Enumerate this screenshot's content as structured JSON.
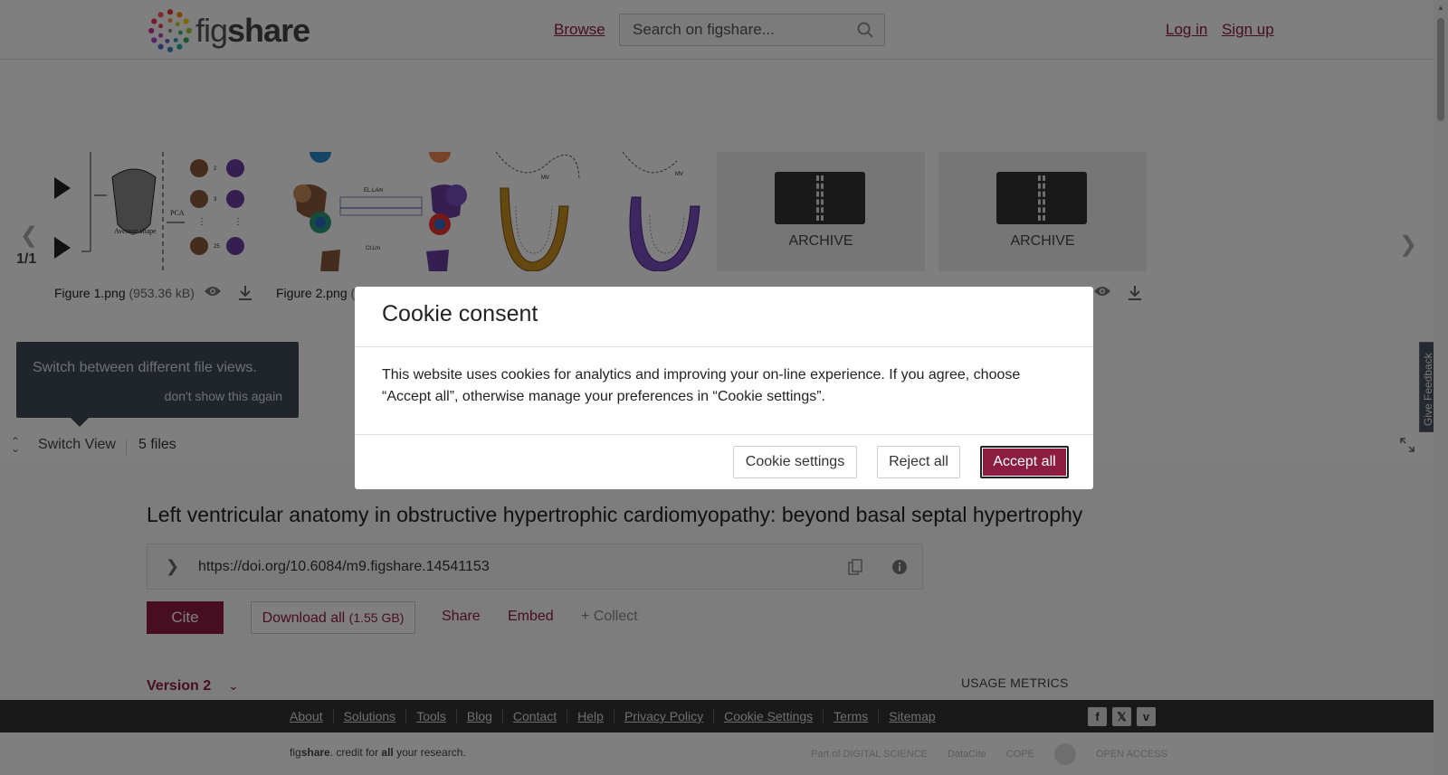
{
  "header": {
    "logo_text_light": "fig",
    "logo_text_bold": "share",
    "browse_label": "Browse",
    "search_placeholder": "Search on figshare...",
    "login_label": "Log in",
    "signup_label": "Sign up"
  },
  "gallery": {
    "page_count": "1/1",
    "files": [
      {
        "name": "Figure 1.png",
        "size": "(953.36 kB)",
        "type": "image"
      },
      {
        "name": "Figure 2.png",
        "size": "(",
        "type": "image"
      },
      {
        "name": "",
        "size": "",
        "type": "image"
      },
      {
        "name": "",
        "size": "",
        "type": "archive",
        "label": "ARCHIVE"
      },
      {
        "name": "",
        "size": "",
        "type": "archive",
        "label": "ARCHIVE"
      }
    ],
    "tooltip": {
      "message": "Switch between different file views.",
      "dismiss": "don't show this again"
    },
    "switch_view_label": "Switch View",
    "files_count": "5 files"
  },
  "article": {
    "title": "Left ventricular anatomy in obstructive hypertrophic cardiomyopathy: beyond basal septal hypertrophy",
    "doi": "https://doi.org/10.6084/m9.figshare.14541153",
    "cite_label": "Cite",
    "download_label": "Download all",
    "download_size": "(1.55 GB)",
    "share_label": "Share",
    "embed_label": "Embed",
    "collect_label": "+ Collect",
    "version_label": "Version 2",
    "usage_label": "USAGE METRICS"
  },
  "feedback_label": "Give Feedback",
  "footer": {
    "links": [
      "About",
      "Solutions",
      "Tools",
      "Blog",
      "Contact",
      "Help",
      "Privacy Policy",
      "Cookie Settings",
      "Terms",
      "Sitemap"
    ],
    "credit_light": "fig",
    "credit_bold": "share",
    "credit_rest_1": ". credit for ",
    "credit_all": "all",
    "credit_rest_2": " your research.",
    "partners": [
      "Part of DIGITAL SCIENCE",
      "DataCite",
      "COPE",
      "",
      "OPEN ACCESS"
    ]
  },
  "cookie_modal": {
    "title": "Cookie consent",
    "body": "This website uses cookies for analytics and improving your on-line experience. If you agree, choose “Accept all”, otherwise manage your preferences in “Cookie settings”.",
    "settings_label": "Cookie settings",
    "reject_label": "Reject all",
    "accept_label": "Accept all"
  },
  "colors": {
    "brand": "#8c1d40",
    "overlay": "rgba(0,0,0,0.5)"
  }
}
